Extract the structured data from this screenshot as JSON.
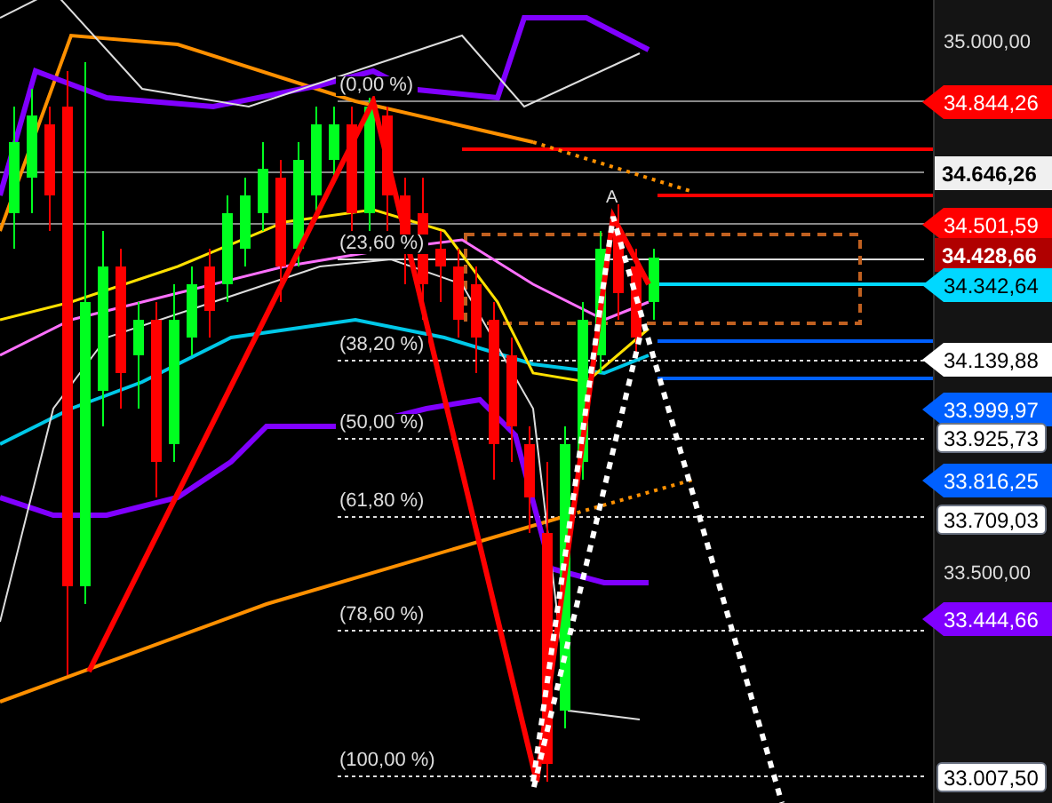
{
  "chart": {
    "peak_label": "A",
    "fib_levels": [
      {
        "label": "(0,00 %)"
      },
      {
        "label": "(23,60 %)"
      },
      {
        "label": "(38,20 %)"
      },
      {
        "label": "(50,00 %)"
      },
      {
        "label": "(61,80 %)"
      },
      {
        "label": "(78,60 %)"
      },
      {
        "label": "(100,00 %)"
      }
    ]
  },
  "price_axis": {
    "ticks": [
      "35.000,00",
      "33.500,00"
    ],
    "markers": [
      {
        "text": "34.844,26",
        "kind": "flag",
        "color": "#ff0000"
      },
      {
        "text": "34.646,26",
        "kind": "box",
        "color": "#f0f0f0"
      },
      {
        "text": "34.501,59",
        "kind": "flag",
        "color": "#ff0000"
      },
      {
        "text": "34.428,66",
        "kind": "box",
        "color": "#b00000"
      },
      {
        "text": "34.342,64",
        "kind": "flag",
        "color": "#00d8ff"
      },
      {
        "text": "34.139,88",
        "kind": "flag",
        "color": "#ffffff"
      },
      {
        "text": "33.999,97",
        "kind": "flag",
        "color": "#0060ff"
      },
      {
        "text": "33.925,73",
        "kind": "tag",
        "color": "#ffffff"
      },
      {
        "text": "33.816,25",
        "kind": "flag",
        "color": "#0060ff"
      },
      {
        "text": "33.709,03",
        "kind": "tag",
        "color": "#ffffff"
      },
      {
        "text": "33.444,66",
        "kind": "flag",
        "color": "#8000ff"
      },
      {
        "text": "33.007,50",
        "kind": "tag",
        "color": "#ffffff"
      }
    ]
  }
}
